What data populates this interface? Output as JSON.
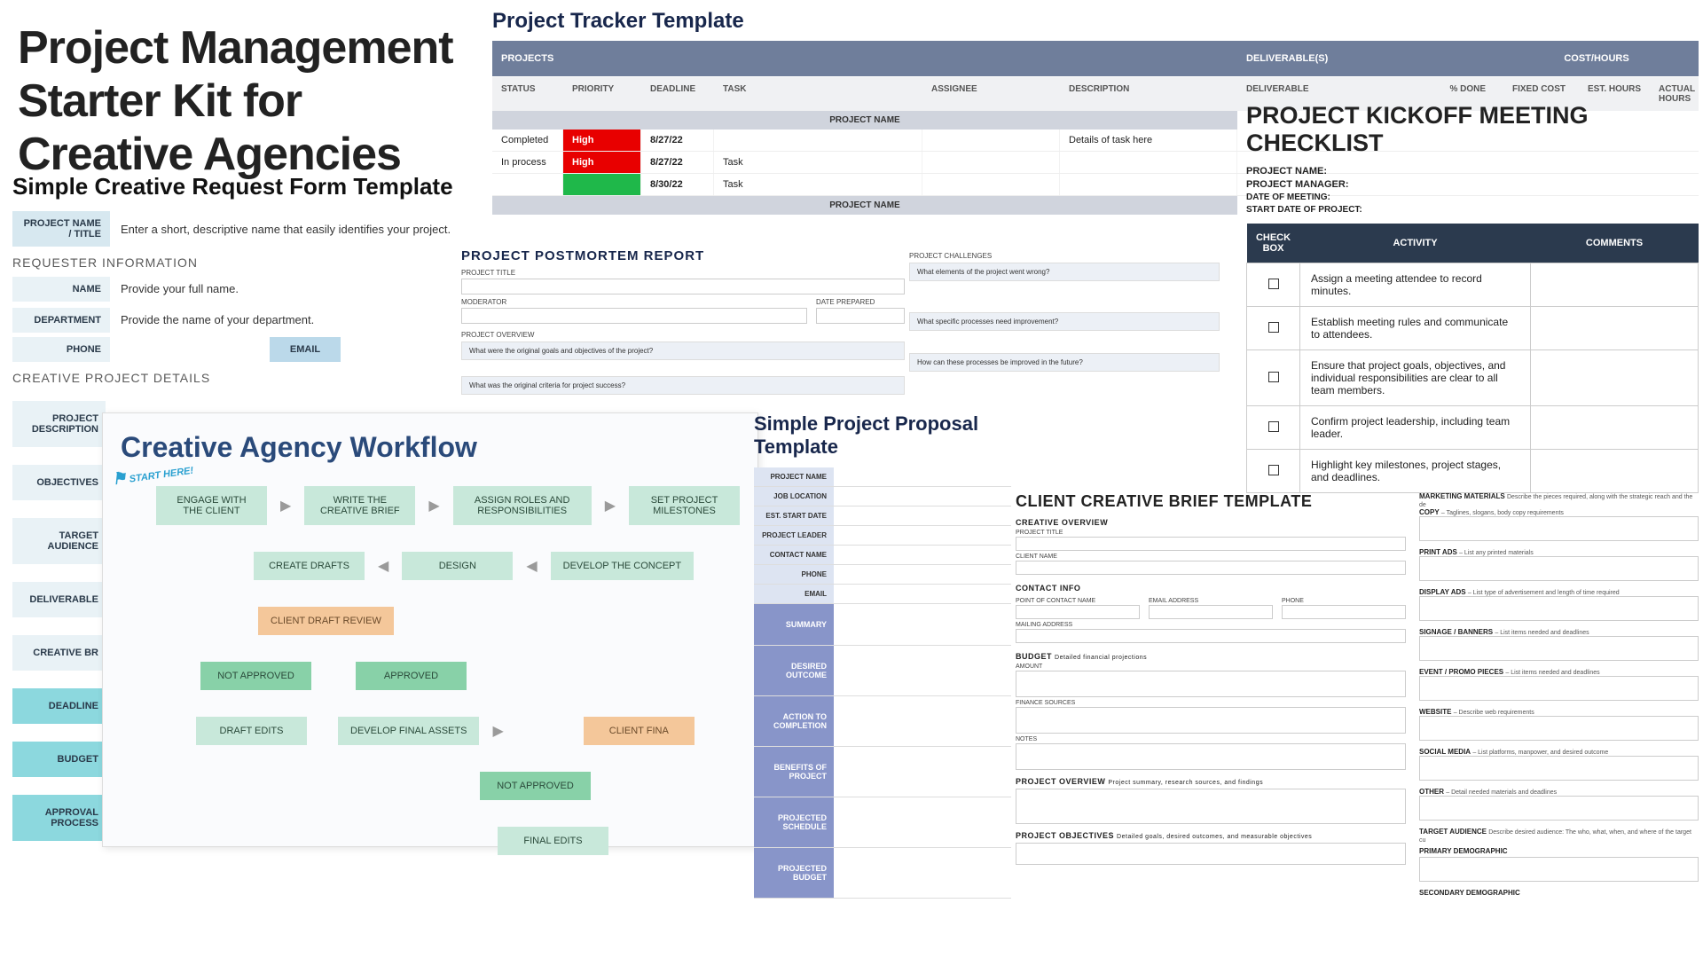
{
  "mainTitle": "Project Management\nStarter Kit for\nCreative Agencies",
  "reqForm": {
    "title": "Simple Creative Request Form Template",
    "projectNameLbl": "PROJECT NAME / TITLE",
    "projectNameHint": "Enter a short, descriptive name that easily identifies your project.",
    "requesterSection": "REQUESTER INFORMATION",
    "nameLbl": "NAME",
    "nameHint": "Provide your full name.",
    "deptLbl": "DEPARTMENT",
    "deptHint": "Provide the name of your department.",
    "phoneLbl": "PHONE",
    "emailLbl": "EMAIL",
    "detailsSection": "CREATIVE PROJECT DETAILS",
    "side": {
      "desc": "PROJECT DESCRIPTION",
      "obj": "OBJECTIVES",
      "aud": "TARGET AUDIENCE",
      "deliv": "DELIVERABLE",
      "cb": "CREATIVE BR",
      "dl": "DEADLINE",
      "budget": "BUDGET",
      "approval": "APPROVAL PROCESS"
    }
  },
  "tracker": {
    "title": "Project Tracker Template",
    "h": {
      "projects": "PROJECTS",
      "deliv": "DELIVERABLE(S)",
      "cost": "COST/HOURS"
    },
    "cols": {
      "status": "STATUS",
      "priority": "PRIORITY",
      "deadline": "DEADLINE",
      "task": "TASK",
      "assignee": "ASSIGNEE",
      "desc": "DESCRIPTION",
      "deliv": "DELIVERABLE",
      "done": "% DONE",
      "fc": "FIXED COST",
      "eh": "EST. HOURS",
      "ah": "ACTUAL HOURS"
    },
    "pn": "PROJECT NAME",
    "rows": [
      {
        "status": "Completed",
        "pri": "High",
        "dl": "8/27/22",
        "task": "",
        "desc": "Details of task here"
      },
      {
        "status": "In process",
        "pri": "High",
        "dl": "8/27/22",
        "task": "Task",
        "desc": ""
      },
      {
        "status": "",
        "pri": "",
        "dl": "8/30/22",
        "task": "Task",
        "desc": ""
      }
    ]
  },
  "postmortem": {
    "title": "PROJECT POSTMORTEM REPORT",
    "projectTitle": "PROJECT TITLE",
    "moderator": "MODERATOR",
    "datePrep": "DATE PREPARED",
    "overview": "PROJECT OVERVIEW",
    "q1": "What were the original goals and objectives of the project?",
    "q2": "What was the original criteria for project success?",
    "challenges": "PROJECT CHALLENGES",
    "q3": "What elements of the project went wrong?",
    "q4": "What specific processes need improvement?",
    "q5": "How can these processes be improved in the future?"
  },
  "kickoff": {
    "title": "PROJECT KICKOFF MEETING CHECKLIST",
    "pn": "PROJECT NAME:",
    "pm": "PROJECT MANAGER:",
    "dom": "DATE OF MEETING:",
    "sdp": "START DATE OF PROJECT:",
    "cols": {
      "cb": "CHECK BOX",
      "act": "ACTIVITY",
      "com": "COMMENTS"
    },
    "acts": [
      "Assign a meeting attendee to record minutes.",
      "Establish meeting rules and communicate to attendees.",
      "Ensure that project goals, objectives, and individual responsibilities are clear to all team members.",
      "Confirm project leadership, including team leader.",
      "Highlight key milestones, project stages, and deadlines."
    ]
  },
  "workflow": {
    "title": "Creative Agency Workflow",
    "start": "START HERE!",
    "boxes": {
      "engage": "ENGAGE WITH THE CLIENT",
      "brief": "WRITE THE CREATIVE BRIEF",
      "roles": "ASSIGN ROLES AND RESPONSIBILITIES",
      "miles": "SET PROJECT MILESTONES",
      "drafts": "CREATE DRAFTS",
      "design": "DESIGN",
      "concept": "DEVELOP THE CONCEPT",
      "review": "CLIENT DRAFT REVIEW",
      "notapp": "NOT APPROVED",
      "app": "APPROVED",
      "edits": "DRAFT EDITS",
      "finalassets": "DEVELOP FINAL ASSETS",
      "clientfinal": "CLIENT FINA",
      "notapp2": "NOT APPROVED",
      "finaledits": "FINAL EDITS"
    }
  },
  "proposal": {
    "title": "Simple Project Proposal Template",
    "rows": {
      "pn": "PROJECT NAME",
      "jl": "JOB LOCATION",
      "esd": "EST. START DATE",
      "pl": "PROJECT LEADER",
      "cn": "CONTACT NAME",
      "ph": "PHONE",
      "em": "EMAIL"
    },
    "secs": {
      "summary": "SUMMARY",
      "outcome": "DESIRED OUTCOME",
      "action": "ACTION TO COMPLETION",
      "benefits": "BENEFITS OF PROJECT",
      "sched": "PROJECTED SCHEDULE",
      "budget": "PROJECTED BUDGET"
    }
  },
  "brief": {
    "title": "CLIENT CREATIVE BRIEF TEMPLATE",
    "sec1": "CREATIVE OVERVIEW",
    "pt": "PROJECT TITLE",
    "cn": "CLIENT NAME",
    "ci": "CONTACT INFO",
    "poc": "POINT OF CONTACT NAME",
    "email": "EMAIL ADDRESS",
    "phone": "PHONE",
    "mail": "MAILING ADDRESS",
    "budget": "BUDGET",
    "budgetDesc": "Detailed financial projections",
    "amount": "AMOUNT",
    "finsrc": "FINANCE SOURCES",
    "notes": "NOTES",
    "povr": "PROJECT OVERVIEW",
    "povrDesc": "Project summary, research sources, and findings",
    "pobj": "PROJECT OBJECTIVES",
    "pobjDesc": "Detailed goals, desired outcomes, and measurable objectives"
  },
  "briefR": {
    "mm": {
      "t": "MARKETING MATERIALS",
      "d": "Describe the pieces required, along with the strategic reach and the de"
    },
    "copy": {
      "t": "COPY",
      "d": "– Taglines, slogans, body copy requirements"
    },
    "print": {
      "t": "PRINT ADS",
      "d": "– List any printed materials"
    },
    "display": {
      "t": "DISPLAY ADS",
      "d": "– List type of advertisement and length of time required"
    },
    "signage": {
      "t": "SIGNAGE / BANNERS",
      "d": "– List items needed and deadlines"
    },
    "event": {
      "t": "EVENT / PROMO PIECES",
      "d": "– List items needed and deadlines"
    },
    "web": {
      "t": "WEBSITE",
      "d": "– Describe web requirements"
    },
    "social": {
      "t": "SOCIAL MEDIA",
      "d": "– List platforms, manpower, and desired outcome"
    },
    "other": {
      "t": "OTHER",
      "d": "– Detail needed materials and deadlines"
    },
    "ta": {
      "t": "TARGET AUDIENCE",
      "d": "Describe desired audience: The who, what, when, and where of the target cu"
    },
    "pd": {
      "t": "PRIMARY DEMOGRAPHIC",
      "d": ""
    },
    "sd": {
      "t": "SECONDARY DEMOGRAPHIC",
      "d": ""
    }
  }
}
